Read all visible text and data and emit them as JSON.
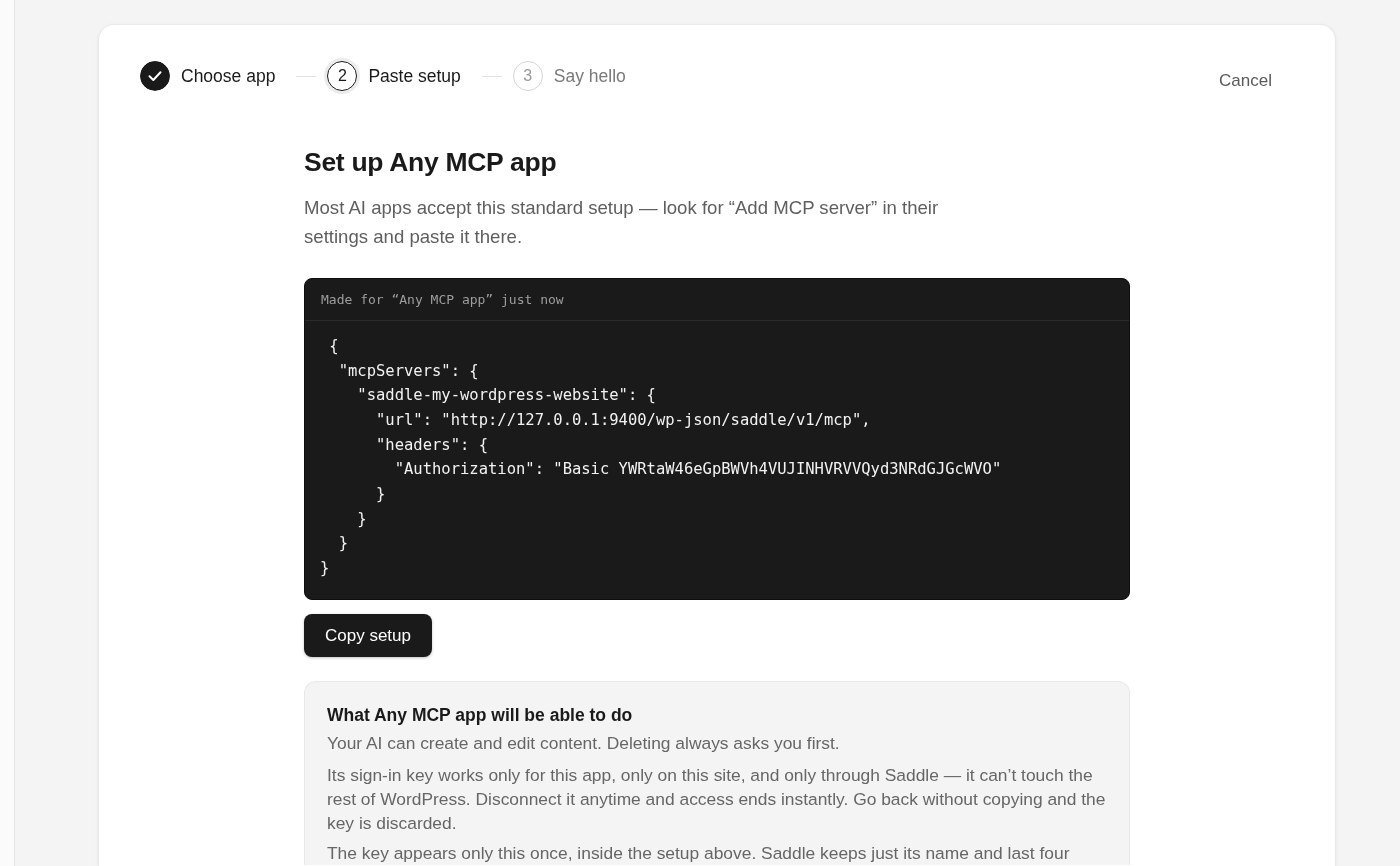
{
  "stepper": {
    "steps": [
      {
        "label": "Choose app",
        "done": true,
        "selected": false
      },
      {
        "number": "2",
        "label": "Paste setup",
        "done": false,
        "selected": true
      },
      {
        "number": "3",
        "label": "Say hello",
        "done": false,
        "selected": false
      }
    ]
  },
  "cancel": "Cancel",
  "heading": "Set up Any MCP app",
  "description": "Most AI apps accept this standard setup — look for “Add MCP server” in their settings and paste it there.",
  "setup_block": {
    "caption": "Made for “Any MCP app” just now",
    "code": " {\n  \"mcpServers\": {\n    \"saddle-my-wordpress-website\": {\n      \"url\": \"http://127.0.0.1:9400/wp-json/saddle/v1/mcp\",\n      \"headers\": {\n        \"Authorization\": \"Basic YWRtaW46eGpBWVh4VUJINHVRVVQyd3NRdGJGcWVO\"\n      }\n    }\n  }\n}"
  },
  "copy_button": "Copy setup",
  "info_panel": {
    "title": "What Any MCP app will be able to do",
    "paragraphs": [
      "Your AI can create and edit content. Deleting always asks you first.",
      "Its sign-in key works only for this app, only on this site, and only through Saddle — it can’t touch the rest of WordPress. Disconnect it anytime and access ends instantly. Go back without copying and the key is discarded.",
      "The key appears only this once, inside the setup above. Saddle keeps just its name and last four"
    ]
  }
}
